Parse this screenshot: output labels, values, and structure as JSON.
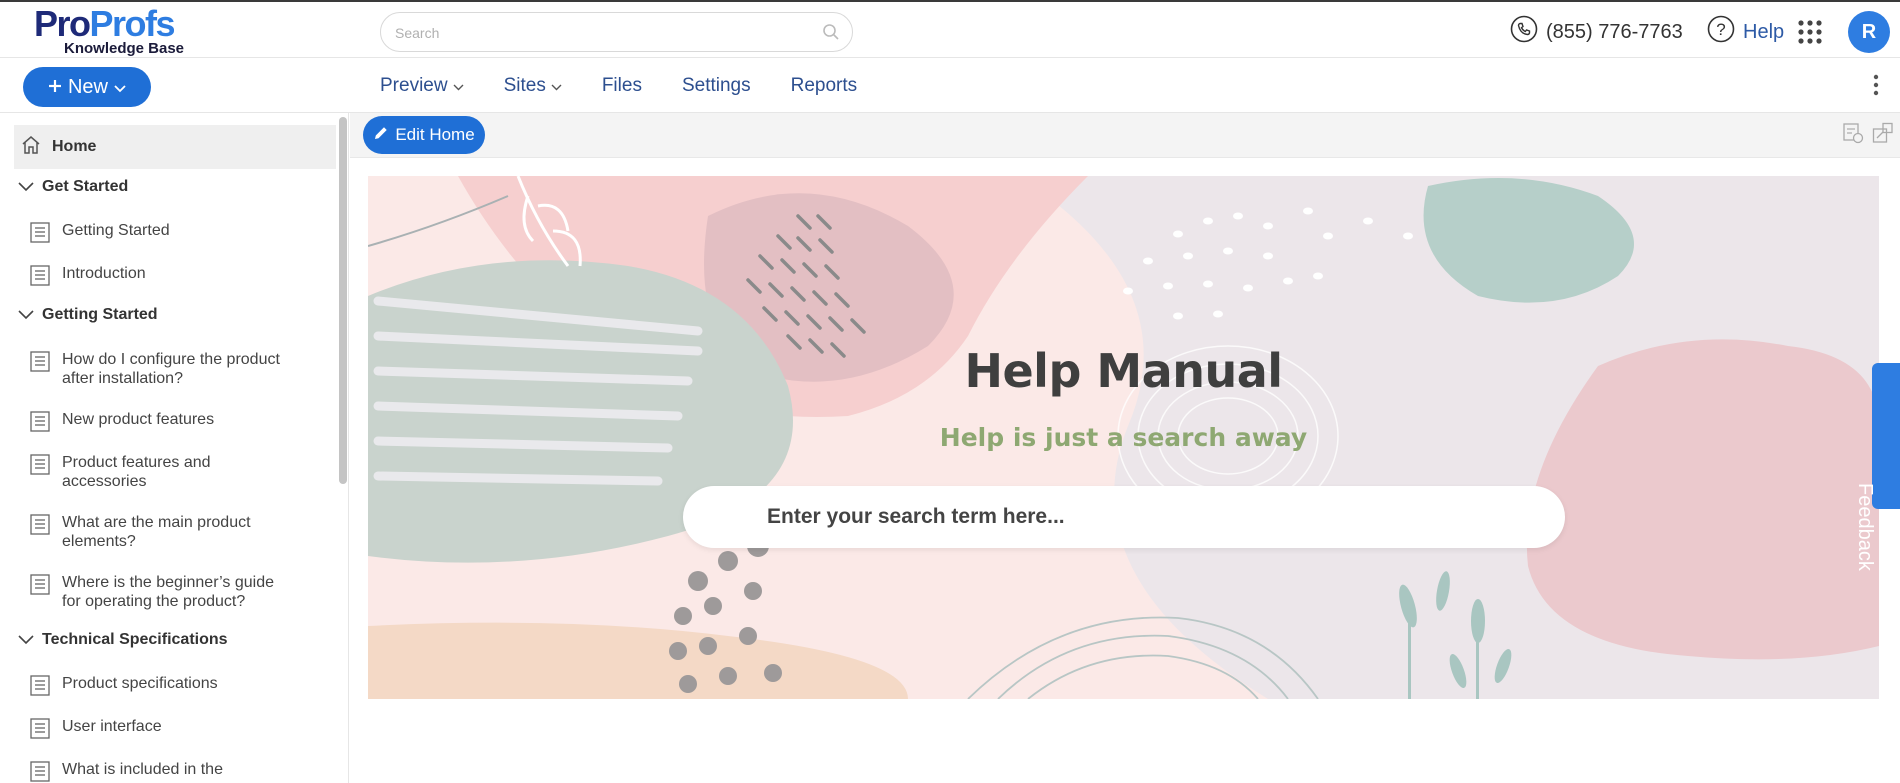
{
  "brand": {
    "logo_pro": "Pro",
    "logo_profs": "Profs",
    "logo_sub": "Knowledge Base"
  },
  "header": {
    "search_placeholder": "Search",
    "phone": "(855) 776-7763",
    "help_label": "Help",
    "avatar_initial": "R"
  },
  "toolbar": {
    "new_label": "New",
    "nav": [
      {
        "label": "Preview",
        "dropdown": true
      },
      {
        "label": "Sites",
        "dropdown": true
      },
      {
        "label": "Files",
        "dropdown": false
      },
      {
        "label": "Settings",
        "dropdown": false
      },
      {
        "label": "Reports",
        "dropdown": false
      }
    ]
  },
  "sidebar": {
    "home_label": "Home",
    "sections": [
      {
        "title": "Get Started",
        "items": [
          "Getting Started",
          "Introduction"
        ]
      },
      {
        "title": "Getting Started",
        "items": [
          "How do I configure the product after installation?",
          "New product features",
          "Product features and accessories",
          "What are the main product elements?",
          "Where is the beginner’s guide for operating the product?"
        ]
      },
      {
        "title": "Technical Specifications",
        "items": [
          "Product specifications",
          "User interface",
          "What is included in the"
        ]
      }
    ]
  },
  "content": {
    "edit_label": "Edit Home",
    "banner_title": "Help Manual",
    "banner_subtitle": "Help is just a search away",
    "banner_search_placeholder": "Enter your search term here...",
    "feedback_label": "Feedback"
  },
  "colors": {
    "primary_blue": "#1f6fd6",
    "nav_text": "#2d4f8f",
    "subtitle_green": "#8ea872",
    "banner_pink": "#fbe9e7"
  }
}
